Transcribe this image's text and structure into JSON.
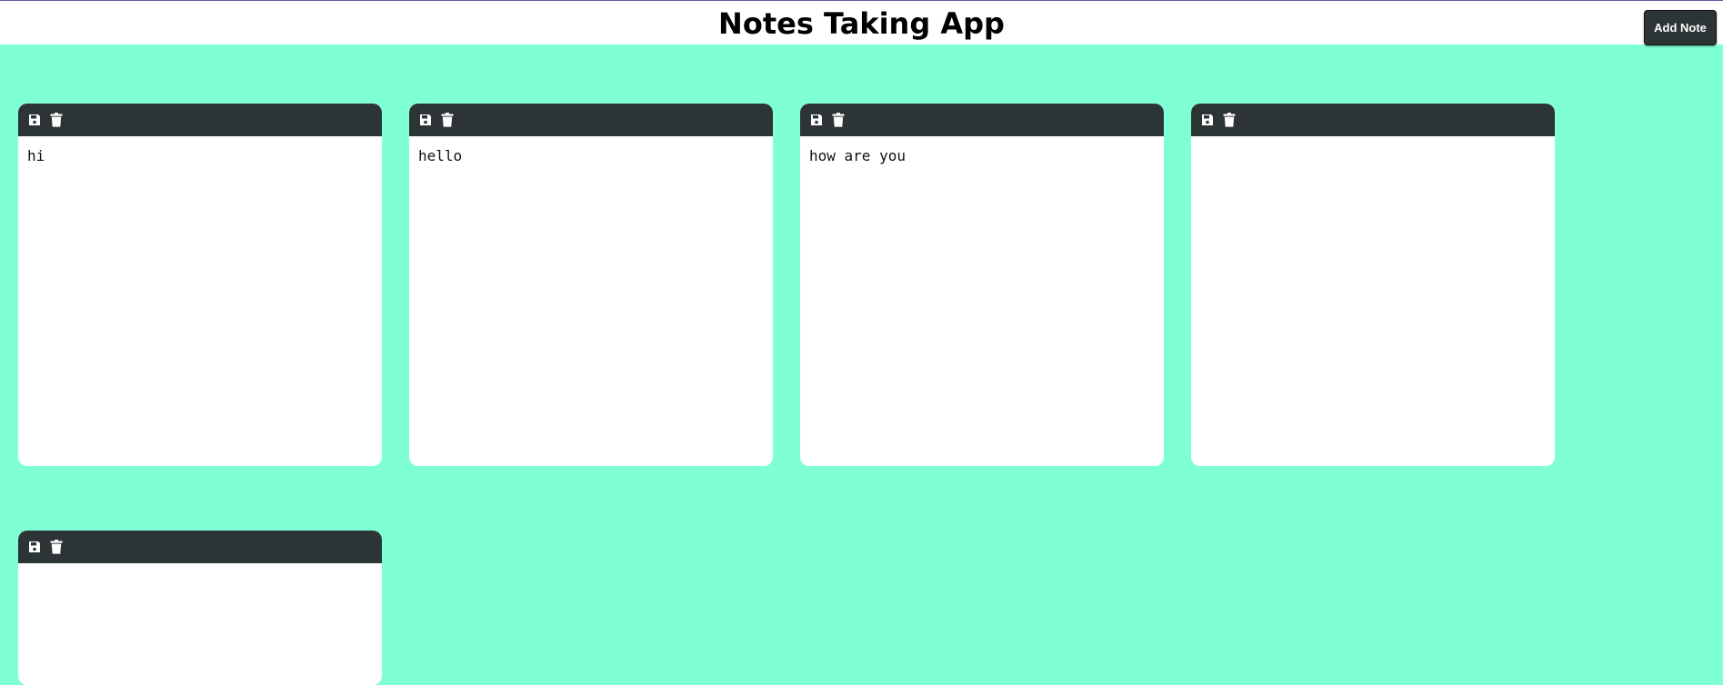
{
  "app": {
    "title": "Notes Taking App",
    "add_button_label": "Add Note"
  },
  "colors": {
    "background": "#7fffd4",
    "header": "#2d3436",
    "card": "#ffffff"
  },
  "notes": [
    {
      "text": "hi",
      "icons": [
        "save-icon",
        "trash-icon"
      ]
    },
    {
      "text": "hello",
      "icons": [
        "save-icon",
        "trash-icon"
      ]
    },
    {
      "text": "how are you",
      "icons": [
        "save-icon",
        "trash-icon"
      ]
    },
    {
      "text": "",
      "icons": [
        "save-icon",
        "trash-icon"
      ]
    },
    {
      "text": "",
      "icons": [
        "save-icon",
        "trash-icon"
      ]
    }
  ]
}
